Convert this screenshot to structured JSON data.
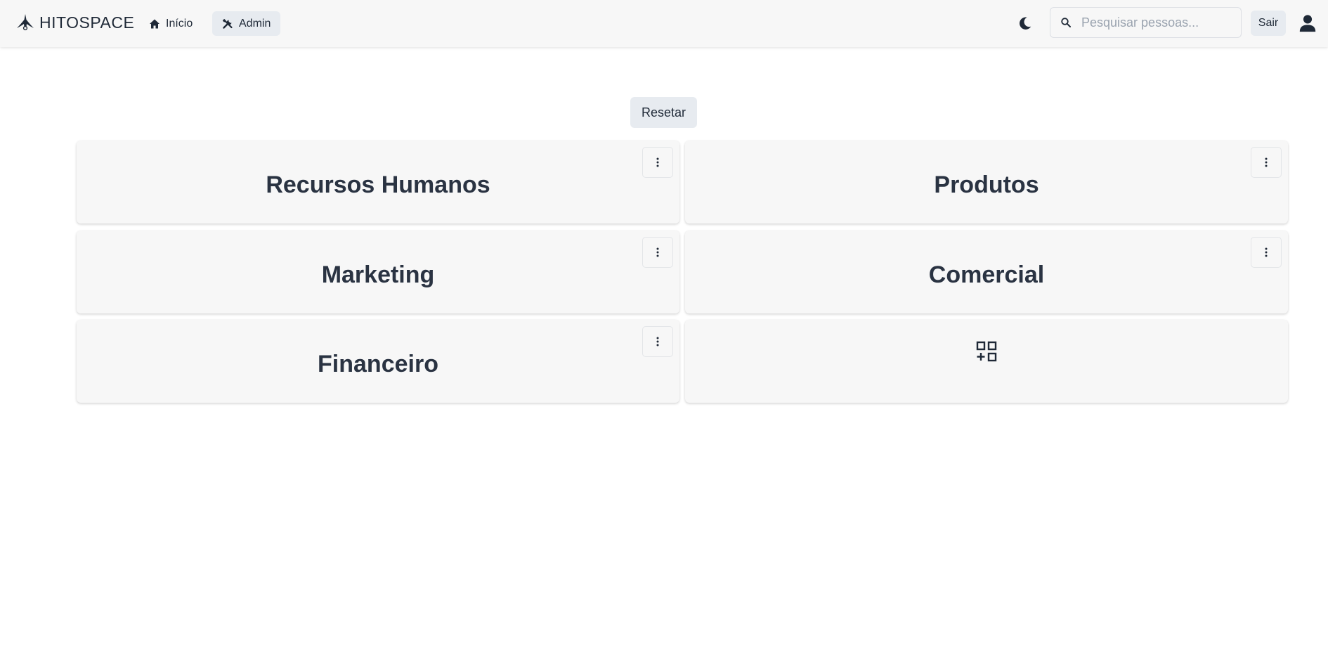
{
  "navbar": {
    "brand": "HITOSPACE",
    "home_label": "Início",
    "admin_label": "Admin",
    "search_placeholder": "Pesquisar pessoas...",
    "search_value": "",
    "logout_label": "Sair",
    "icons": {
      "brand": "hitospace-logo-icon",
      "home": "home-icon",
      "admin": "tools-icon",
      "theme": "moon-icon",
      "search": "search-icon",
      "avatar": "user-icon"
    }
  },
  "main": {
    "reset_label": "Resetar",
    "departments": [
      {
        "name": "Recursos Humanos"
      },
      {
        "name": "Produtos"
      },
      {
        "name": "Marketing"
      },
      {
        "name": "Comercial"
      },
      {
        "name": "Financeiro"
      }
    ],
    "add_card_icon": "add-grid-icon",
    "menu_icon": "more-vertical-icon"
  },
  "colors": {
    "navbar_bg": "#f7f7f7",
    "card_bg": "#f7f7f7",
    "button_bg": "#e7ebf0",
    "title_text": "#2a3342"
  }
}
